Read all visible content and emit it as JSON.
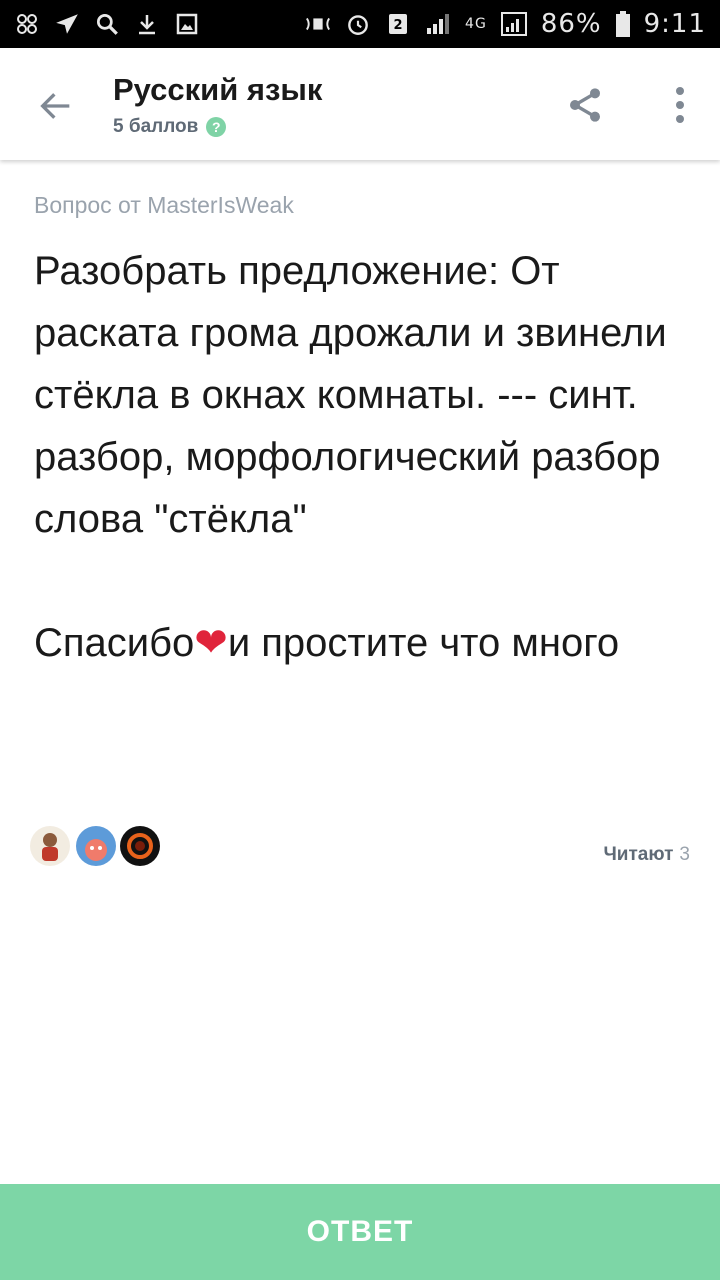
{
  "status_bar": {
    "battery": "86%",
    "time": "9:11",
    "network": "4G",
    "left_icons": [
      "notification-app-icon",
      "send-icon",
      "search-icon",
      "download-icon",
      "image-icon"
    ],
    "right_icons": [
      "signal-sync-icon",
      "alarm-icon",
      "sim-icon",
      "signal-bars-icon",
      "battery-icon"
    ]
  },
  "header": {
    "subject": "Русский язык",
    "points": "5 баллов",
    "help_symbol": "?"
  },
  "question": {
    "asked_by": "Вопрос от MasterIsWeak",
    "text_main": "Разобрать предложение: От раската грома дрожали и звинели стёкла в окнах комнаты. --- синт. разбор, морфологический разбор слова \"стёкла\"",
    "text_thanks_a": "Спасибо",
    "heart": "❤",
    "text_thanks_b": "и простите что много"
  },
  "readers": {
    "label": "Читают",
    "count": "3"
  },
  "answer_button": {
    "label": "ОТВЕТ"
  },
  "colors": {
    "accent": "#7dd6a6",
    "text": "#1a1a1a",
    "muted": "#9aa3ad"
  }
}
